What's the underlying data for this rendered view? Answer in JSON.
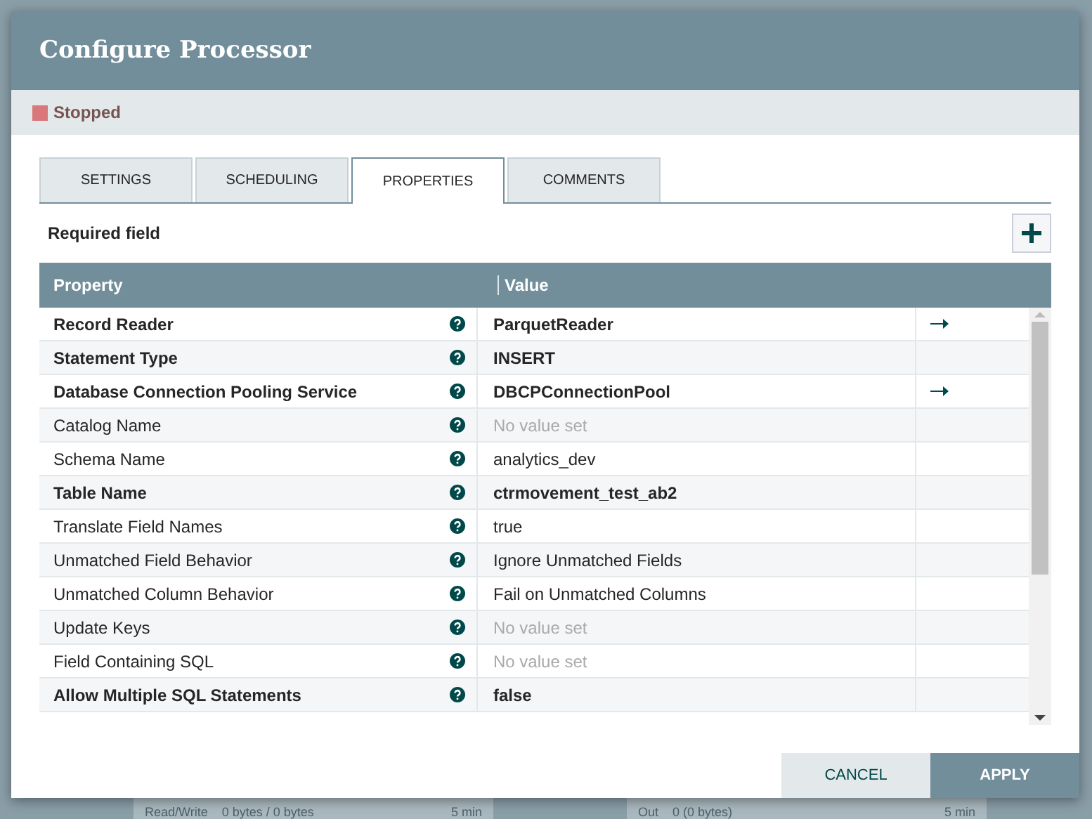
{
  "dialog": {
    "title": "Configure Processor",
    "status": {
      "label": "Stopped",
      "color": "#d9787b"
    }
  },
  "tabs": [
    {
      "label": "SETTINGS",
      "selected": false
    },
    {
      "label": "SCHEDULING",
      "selected": false
    },
    {
      "label": "PROPERTIES",
      "selected": true
    },
    {
      "label": "COMMENTS",
      "selected": false
    }
  ],
  "required_note": "Required field",
  "table": {
    "columns": [
      "Property",
      "Value"
    ],
    "rows": [
      {
        "name": "Record Reader",
        "required": true,
        "value": "ParquetReader",
        "value_set": true,
        "link": true
      },
      {
        "name": "Statement Type",
        "required": true,
        "value": "INSERT",
        "value_set": true,
        "link": false
      },
      {
        "name": "Database Connection Pooling Service",
        "required": true,
        "value": "DBCPConnectionPool",
        "value_set": true,
        "link": true
      },
      {
        "name": "Catalog Name",
        "required": false,
        "value": "No value set",
        "value_set": false,
        "link": false
      },
      {
        "name": "Schema Name",
        "required": false,
        "value": "analytics_dev",
        "value_set": true,
        "link": false
      },
      {
        "name": "Table Name",
        "required": true,
        "value": "ctrmovement_test_ab2",
        "value_set": true,
        "link": false
      },
      {
        "name": "Translate Field Names",
        "required": false,
        "value": "true",
        "value_set": true,
        "link": false
      },
      {
        "name": "Unmatched Field Behavior",
        "required": false,
        "value": "Ignore Unmatched Fields",
        "value_set": true,
        "link": false
      },
      {
        "name": "Unmatched Column Behavior",
        "required": false,
        "value": "Fail on Unmatched Columns",
        "value_set": true,
        "link": false
      },
      {
        "name": "Update Keys",
        "required": false,
        "value": "No value set",
        "value_set": false,
        "link": false
      },
      {
        "name": "Field Containing SQL",
        "required": false,
        "value": "No value set",
        "value_set": false,
        "link": false
      },
      {
        "name": "Allow Multiple SQL Statements",
        "required": true,
        "value": "false",
        "value_set": true,
        "link": false
      }
    ]
  },
  "buttons": [
    {
      "label": "CANCEL",
      "kind": "secondary"
    },
    {
      "label": "APPLY",
      "kind": "primary"
    }
  ],
  "background_texts": [
    {
      "label": "Read/Write",
      "value": "0 bytes / 0 bytes",
      "time": "5 min"
    },
    {
      "label": "Out",
      "value": "0 (0 bytes)",
      "time": "5 min"
    }
  ]
}
